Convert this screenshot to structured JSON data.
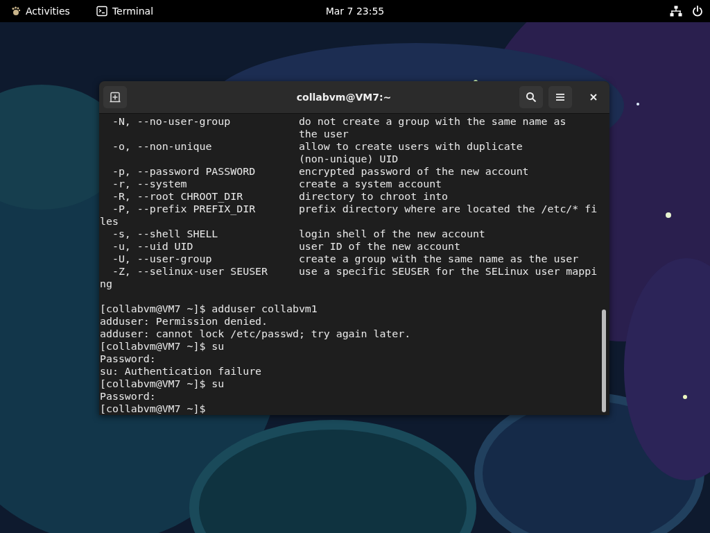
{
  "top_bar": {
    "activities": "Activities",
    "app_menu": "Terminal",
    "clock": "Mar 7  23:55"
  },
  "window": {
    "title": "collabvm@VM7:~"
  },
  "terminal": {
    "lines": [
      {
        "kind": "text",
        "text": "  -N, --no-user-group           do not create a group with the same name as"
      },
      {
        "kind": "text",
        "text": "                                the user"
      },
      {
        "kind": "text",
        "text": "  -o, --non-unique              allow to create users with duplicate"
      },
      {
        "kind": "text",
        "text": "                                (non-unique) UID"
      },
      {
        "kind": "text",
        "text": "  -p, --password PASSWORD       encrypted password of the new account"
      },
      {
        "kind": "text",
        "text": "  -r, --system                  create a system account"
      },
      {
        "kind": "text",
        "text": "  -R, --root CHROOT_DIR         directory to chroot into"
      },
      {
        "kind": "text",
        "text": "  -P, --prefix PREFIX_DIR       prefix directory where are located the /etc/* fi"
      },
      {
        "kind": "text",
        "text": "les"
      },
      {
        "kind": "text",
        "text": "  -s, --shell SHELL             login shell of the new account"
      },
      {
        "kind": "text",
        "text": "  -u, --uid UID                 user ID of the new account"
      },
      {
        "kind": "text",
        "text": "  -U, --user-group              create a group with the same name as the user"
      },
      {
        "kind": "text",
        "text": "  -Z, --selinux-user SEUSER     use a specific SEUSER for the SELinux user mappi"
      },
      {
        "kind": "text",
        "text": "ng"
      },
      {
        "kind": "blank"
      },
      {
        "kind": "text",
        "text": "[collabvm@VM7 ~]$ adduser collabvm1"
      },
      {
        "kind": "text",
        "text": "adduser: Permission denied."
      },
      {
        "kind": "text",
        "text": "adduser: cannot lock /etc/passwd; try again later."
      },
      {
        "kind": "text",
        "text": "[collabvm@VM7 ~]$ su"
      },
      {
        "kind": "text",
        "text": "Password:"
      },
      {
        "kind": "text",
        "text": "su: Authentication failure"
      },
      {
        "kind": "text",
        "text": "[collabvm@VM7 ~]$ su"
      },
      {
        "kind": "text",
        "text": "Password:"
      },
      {
        "kind": "text",
        "text": "[collabvm@VM7 ~]$"
      }
    ]
  }
}
